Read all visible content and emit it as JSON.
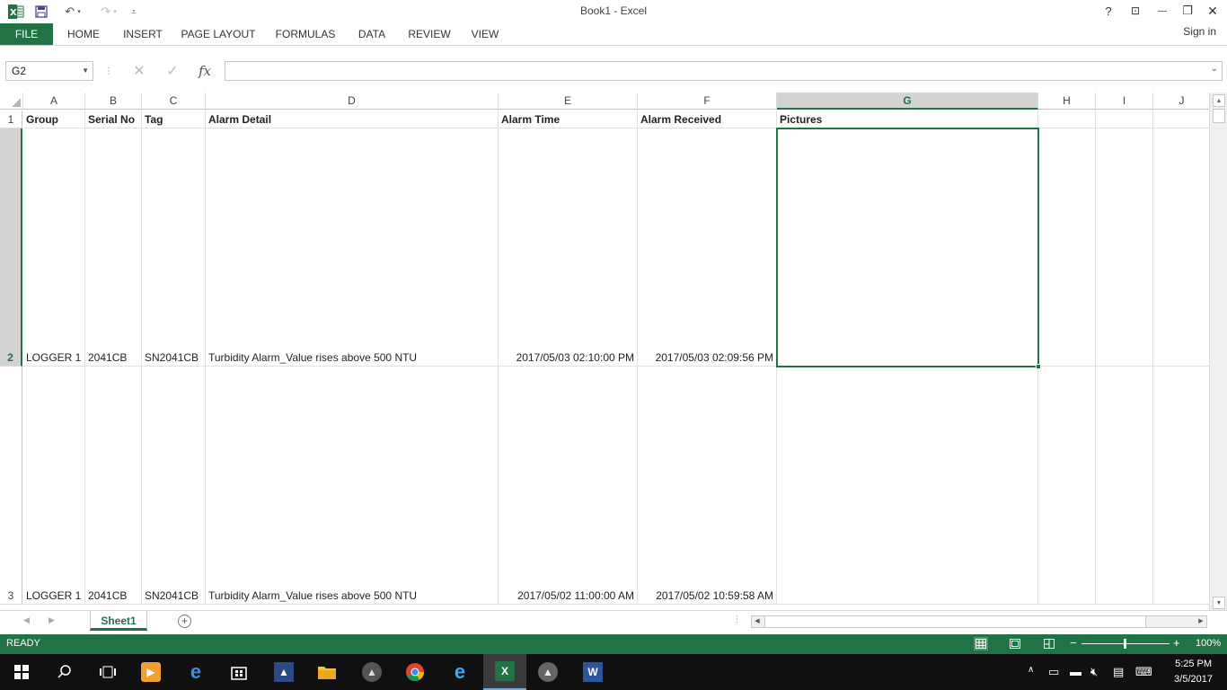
{
  "window": {
    "title": "Book1 - Excel",
    "help": "?",
    "restore_ribbon": "⊡",
    "minimize": "—",
    "maximize": "❐",
    "close": "✕"
  },
  "quick_access": {
    "app_icon": "excel-logo-icon",
    "save": "save-icon",
    "undo": "undo-icon",
    "redo": "redo-icon",
    "customize": "customize-icon"
  },
  "ribbon": {
    "tabs": [
      "FILE",
      "HOME",
      "INSERT",
      "PAGE LAYOUT",
      "FORMULAS",
      "DATA",
      "REVIEW",
      "VIEW"
    ],
    "sign_in": "Sign in"
  },
  "formula_bar": {
    "name_box": "G2",
    "fx": "fx",
    "content": ""
  },
  "columns": [
    "A",
    "B",
    "C",
    "D",
    "E",
    "F",
    "G",
    "H",
    "I",
    "J"
  ],
  "selected_column": "G",
  "rows": [
    {
      "row": "1",
      "cells": [
        "Group",
        "Serial No",
        "Tag",
        "Alarm Detail",
        "Alarm Time",
        "Alarm Received",
        "Pictures",
        "",
        "",
        ""
      ]
    },
    {
      "row": "2",
      "cells": [
        "LOGGER 1",
        "2041CB",
        "SN2041CB",
        "Turbidity Alarm_Value rises above 500 NTU",
        "2017/05/03 02:10:00 PM",
        "2017/05/03 02:09:56 PM",
        "",
        "",
        "",
        ""
      ]
    },
    {
      "row": "3",
      "cells": [
        "LOGGER 1",
        "2041CB",
        "SN2041CB",
        "Turbidity Alarm_Value rises above 500 NTU",
        "2017/05/02 11:00:00 AM",
        "2017/05/02 10:59:58 AM",
        "",
        "",
        "",
        ""
      ]
    }
  ],
  "sheets": {
    "active": "Sheet1",
    "add": "+"
  },
  "status": {
    "text": "READY",
    "zoom": "100%"
  },
  "taskbar": {
    "clock_time": "5:25 PM",
    "clock_date": "3/5/2017"
  },
  "colors": {
    "accent": "#217346",
    "taskbar": "#101010"
  }
}
